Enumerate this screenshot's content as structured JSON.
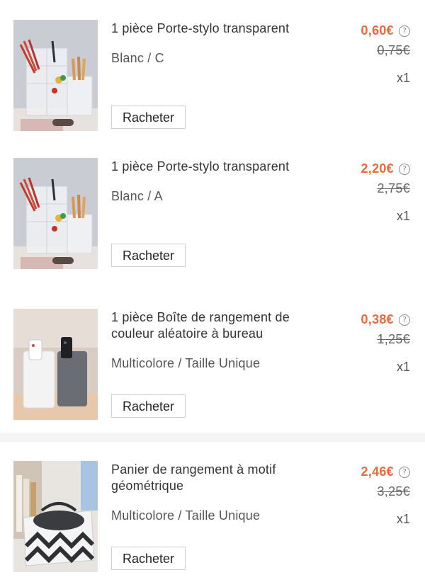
{
  "colors": {
    "price_accent": "#ea6a3e",
    "text_primary": "#333333",
    "separator": "#f4f4f4"
  },
  "icons": {
    "help": "question-circle-icon"
  },
  "items": [
    {
      "title": "1 pièce Porte-stylo transparent",
      "variant": "Blanc / C",
      "price": "0,60€",
      "original_price": "0,75€",
      "quantity": "x1",
      "button": "Racheter",
      "image": "pen-holder-photo"
    },
    {
      "title": "1 pièce Porte-stylo transparent",
      "variant": "Blanc / A",
      "price": "2,20€",
      "original_price": "2,75€",
      "quantity": "x1",
      "button": "Racheter",
      "image": "pen-holder-photo"
    },
    {
      "title": "1 pièce Boîte de rangement de couleur aléatoire à bureau",
      "variant": "Multicolore / Taille Unique",
      "price": "0,38€",
      "original_price": "1,25€",
      "quantity": "x1",
      "button": "Racheter",
      "image": "storage-cups-photo"
    },
    {
      "title": "Panier de rangement à motif géométrique",
      "variant": "Multicolore / Taille Unique",
      "price": "2,46€",
      "original_price": "3,25€",
      "quantity": "x1",
      "button": "Racheter",
      "image": "storage-basket-photo"
    }
  ]
}
